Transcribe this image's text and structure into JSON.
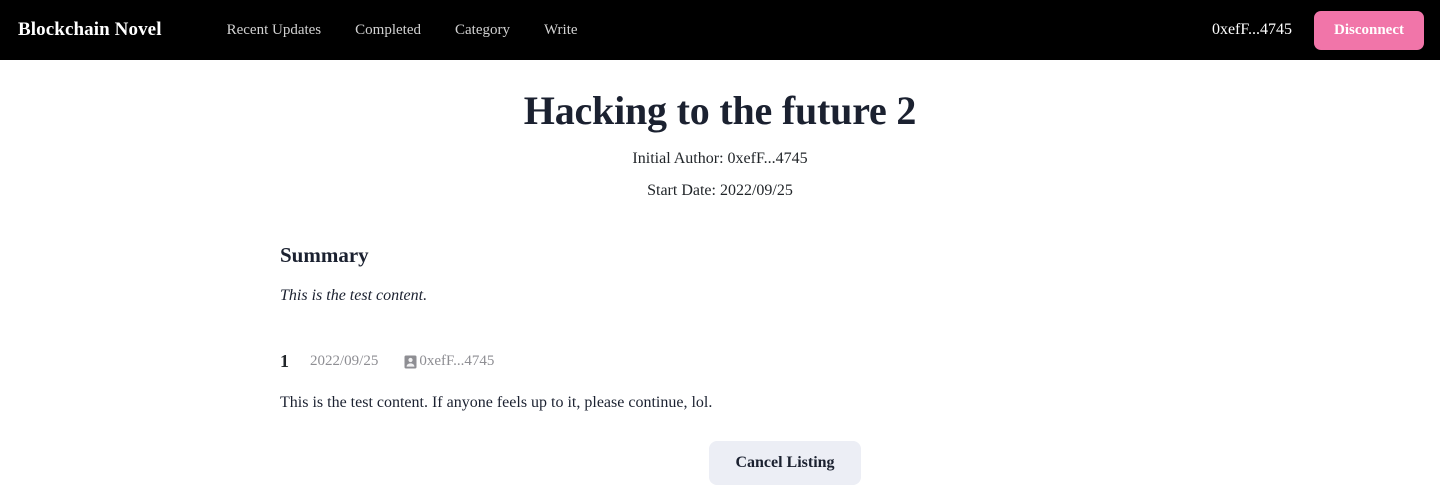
{
  "navbar": {
    "brand": "Blockchain Novel",
    "links": [
      {
        "label": "Recent Updates"
      },
      {
        "label": "Completed"
      },
      {
        "label": "Category"
      },
      {
        "label": "Write"
      }
    ],
    "wallet_address": "0xefF...4745",
    "disconnect_label": "Disconnect",
    "background_color": "#000000",
    "disconnect_color": "#f175a9"
  },
  "novel": {
    "title": "Hacking to the future 2",
    "initial_author_line": "Initial Author: 0xefF...4745",
    "start_date_line": "Start Date: 2022/09/25"
  },
  "summary": {
    "heading": "Summary",
    "text": "This is the test content."
  },
  "chapters": [
    {
      "number": "1",
      "date": "2022/09/25",
      "author": "0xefF...4745",
      "author_icon": "user-card-icon",
      "body": "This is the test content. If anyone feels up to it, please continue, lol."
    }
  ],
  "actions": {
    "cancel_listing_label": "Cancel Listing",
    "cancel_listing_color": "#eceef5"
  }
}
